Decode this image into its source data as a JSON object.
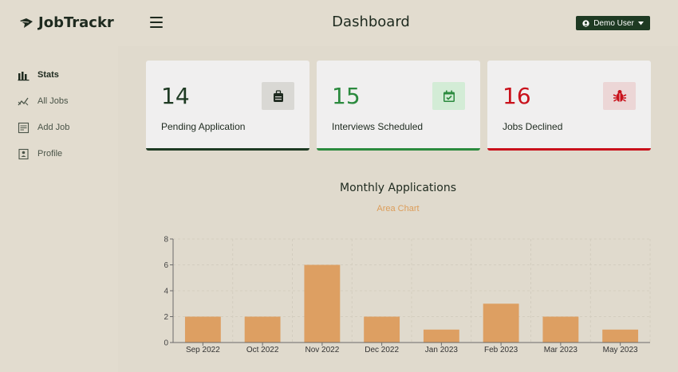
{
  "app": {
    "name": "JobTrackr"
  },
  "sidebar": {
    "items": [
      {
        "label": "Stats",
        "icon": "bar-chart-icon",
        "active": true
      },
      {
        "label": "All Jobs",
        "icon": "trend-chart-icon",
        "active": false
      },
      {
        "label": "Add Job",
        "icon": "form-icon",
        "active": false
      },
      {
        "label": "Profile",
        "icon": "id-card-icon",
        "active": false
      }
    ]
  },
  "header": {
    "title": "Dashboard",
    "user_label": "Demo User"
  },
  "stats": [
    {
      "count": "14",
      "label": "Pending Application",
      "icon": "briefcase-icon",
      "color": "#1e3a23",
      "icon_bg": "#d9d8d4"
    },
    {
      "count": "15",
      "label": "Interviews Scheduled",
      "icon": "calendar-check-icon",
      "color": "#2b8a3e",
      "icon_bg": "#d3ecd6"
    },
    {
      "count": "16",
      "label": "Jobs Declined",
      "icon": "bug-icon",
      "color": "#c9111b",
      "icon_bg": "#ecd6d6"
    }
  ],
  "chart": {
    "title": "Monthly Applications",
    "toggle_label": "Area Chart"
  },
  "chart_data": {
    "type": "bar",
    "categories": [
      "Sep 2022",
      "Oct 2022",
      "Nov 2022",
      "Dec 2022",
      "Jan 2023",
      "Feb 2023",
      "Mar 2023",
      "May 2023"
    ],
    "values": [
      2,
      2,
      6,
      2,
      1,
      3,
      2,
      1
    ],
    "ylim": [
      0,
      8
    ],
    "yticks": [
      0,
      2,
      4,
      6,
      8
    ],
    "grid": true,
    "bar_color": "#dd9f62"
  }
}
